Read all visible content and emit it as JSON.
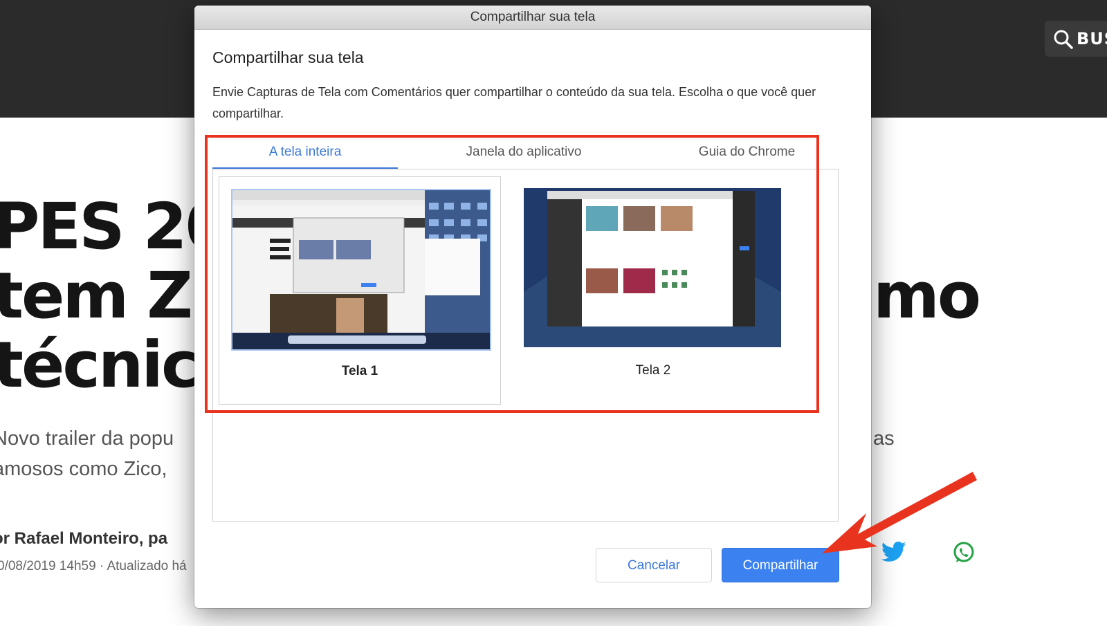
{
  "page": {
    "search_label": "BUS",
    "headline_left": [
      "PES 202",
      "tem Zic",
      "técnico"
    ],
    "headline_right": "mo",
    "subtitle_left": [
      "Novo trailer da popu",
      "amosos como Zico, "
    ],
    "subtitle_right": "as",
    "author": "or Rafael Monteiro, pa",
    "dateline": "0/08/2019 14h59 · Atualizado há",
    "colors": {
      "topbar": "#2b2b2b",
      "twitter": "#1da1f2",
      "whatsapp": "#25a244"
    }
  },
  "dialog": {
    "window_title": "Compartilhar sua tela",
    "heading": "Compartilhar sua tela",
    "description": "Envie Capturas de Tela com Comentários quer compartilhar o conteúdo da sua tela. Escolha o que você quer compartilhar.",
    "tabs": [
      {
        "label": "A tela inteira",
        "active": true
      },
      {
        "label": "Janela do aplicativo",
        "active": false
      },
      {
        "label": "Guia do Chrome",
        "active": false
      }
    ],
    "screens": [
      {
        "label": "Tela 1",
        "selected": true
      },
      {
        "label": "Tela 2",
        "selected": false
      }
    ],
    "cancel_label": "Cancelar",
    "share_label": "Compartilhar",
    "accent_color": "#3b78d8",
    "highlight_color": "#e8331f"
  }
}
